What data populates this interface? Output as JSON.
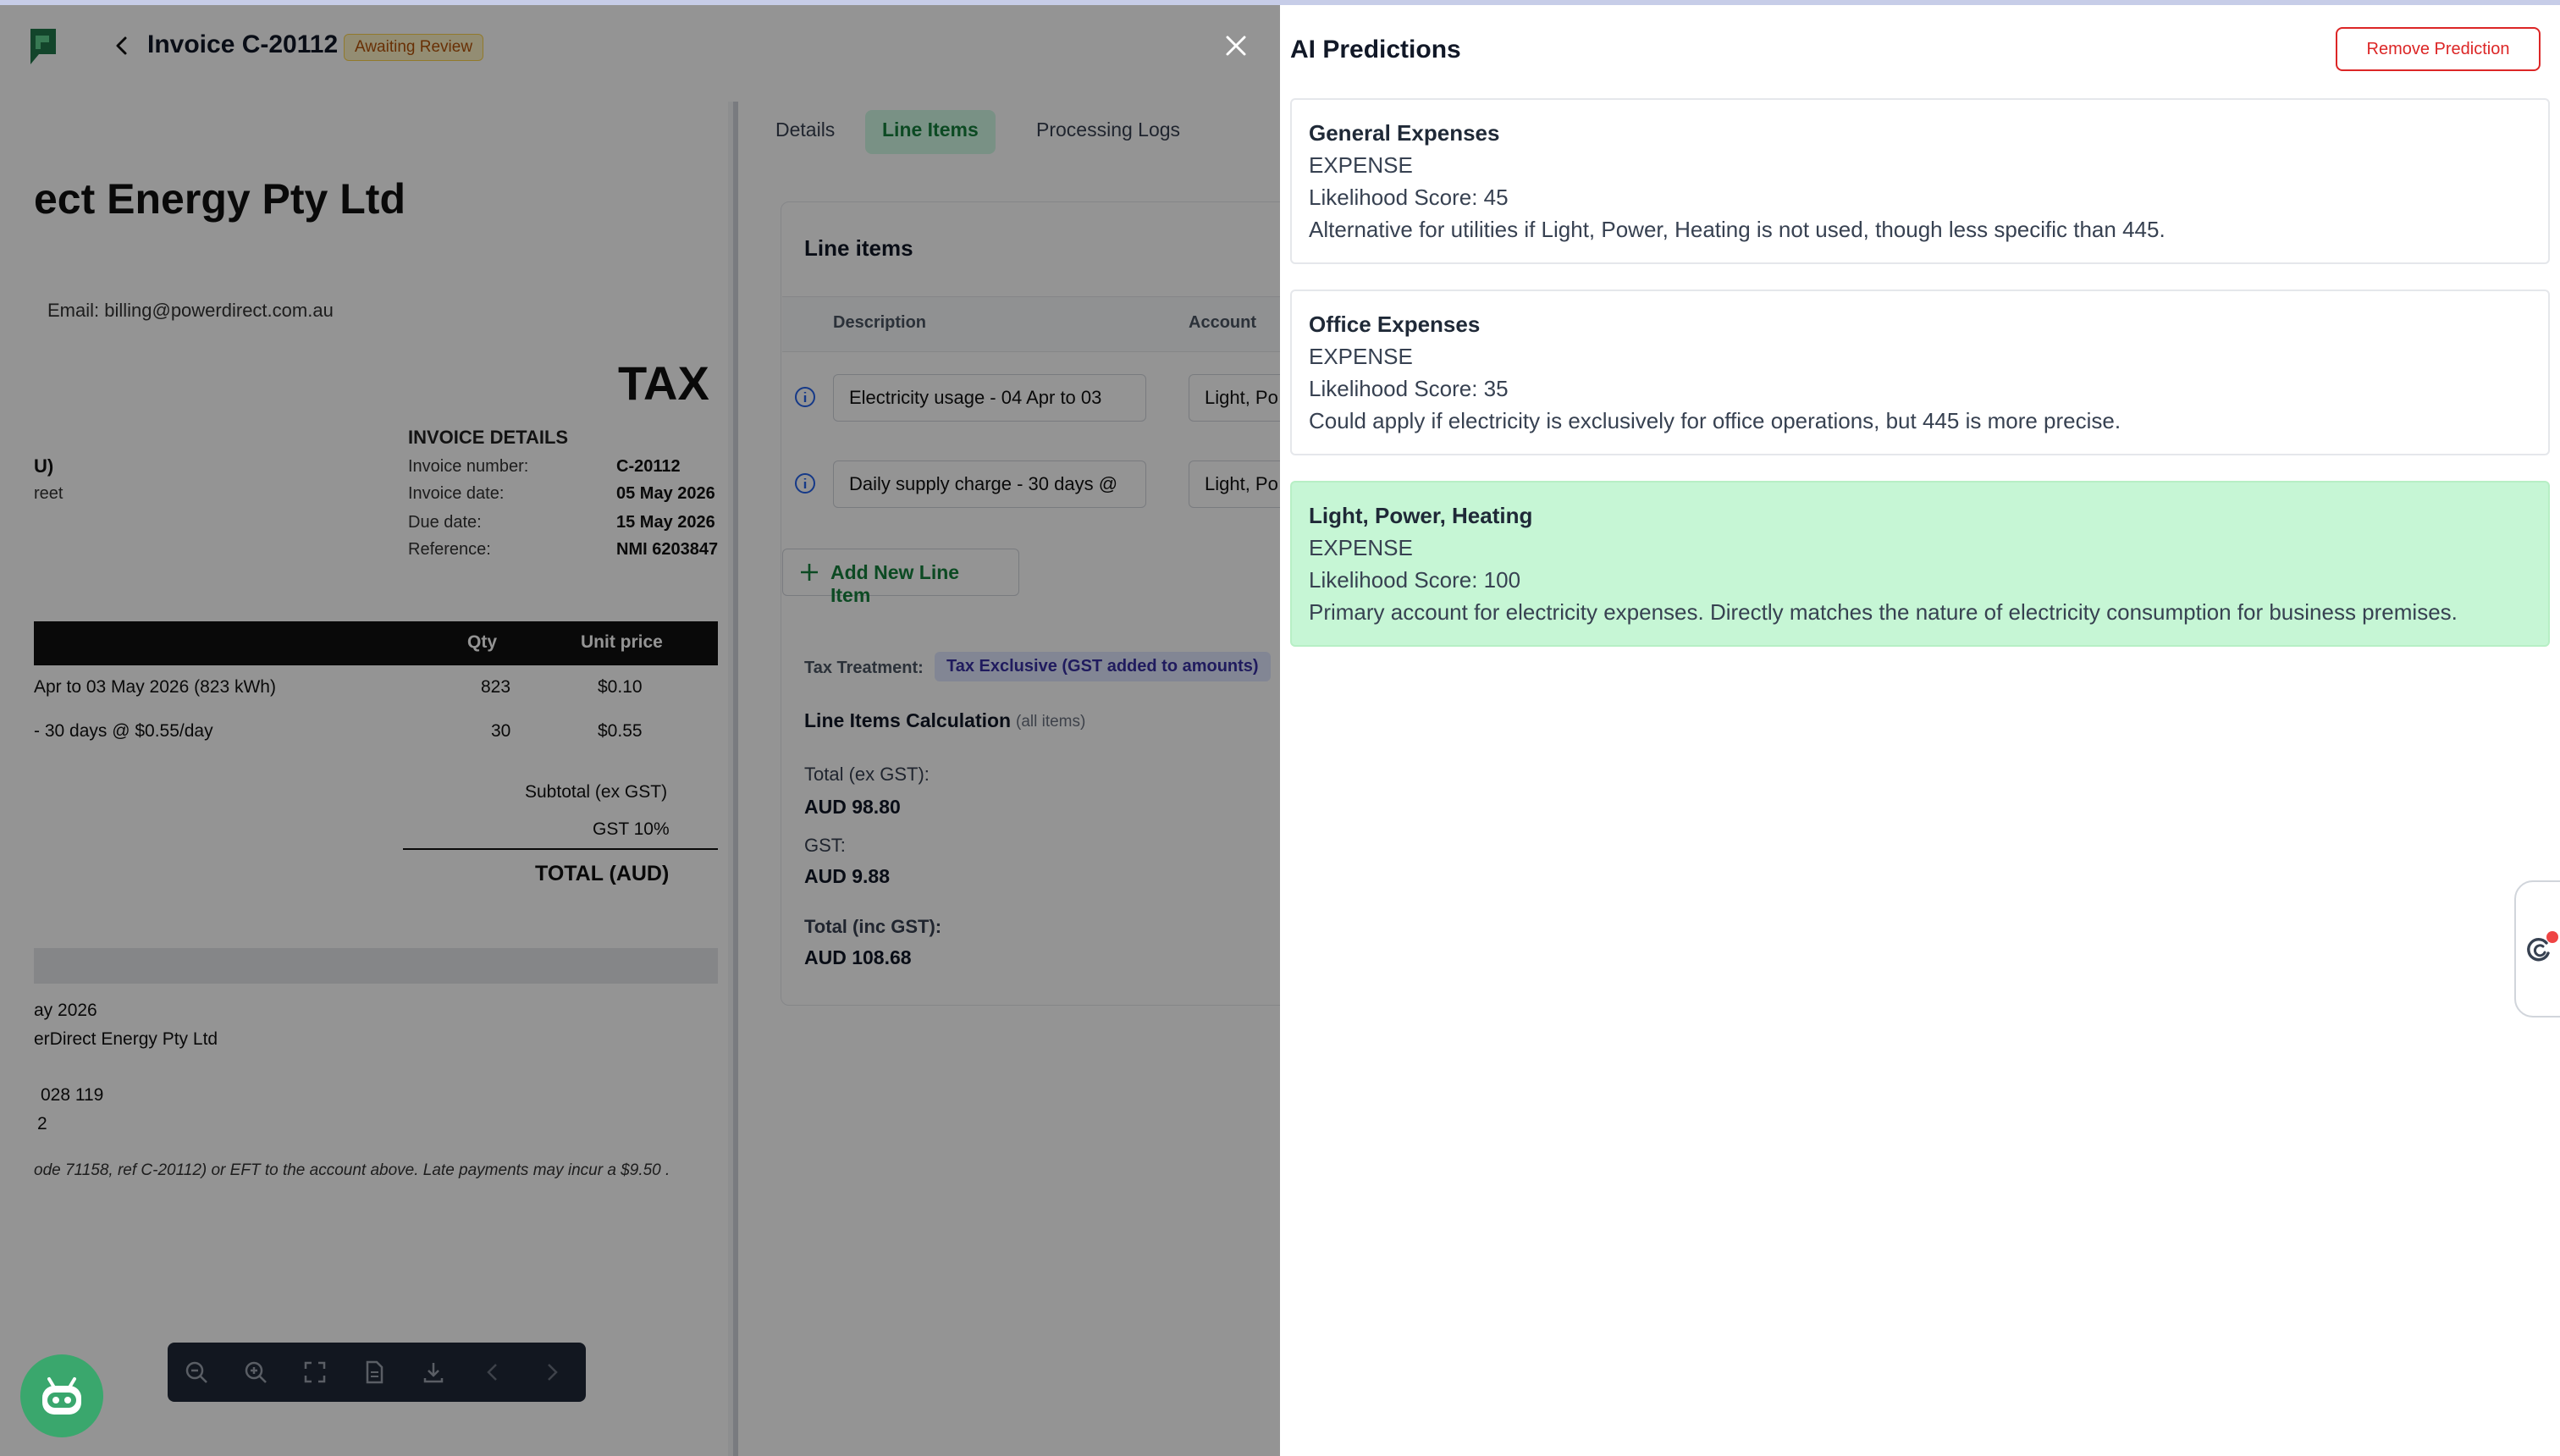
{
  "header": {
    "invoice_title": "Invoice C-20112",
    "status": "Awaiting Review"
  },
  "pdf": {
    "company_partial": "ect Energy Pty Ltd",
    "email": "Email: billing@powerdirect.com.au",
    "doc_type": "TAX",
    "details_heading": "INVOICE DETAILS",
    "details": [
      {
        "k": "Invoice number:",
        "v": "C-20112"
      },
      {
        "k": "Invoice date:",
        "v": "05 May 2026"
      },
      {
        "k": "Due date:",
        "v": "15 May 2026"
      },
      {
        "k": "Reference:",
        "v": "NMI 6203847"
      }
    ],
    "bill_to_partial": "U)",
    "street_partial": "reet",
    "table_headers": {
      "qty": "Qty",
      "unit_price": "Unit price"
    },
    "rows": [
      {
        "desc": "Apr to 03 May 2026 (823 kWh)",
        "qty": "823",
        "price": "$0.10"
      },
      {
        "desc": "- 30 days @ $0.55/day",
        "qty": "30",
        "price": "$0.55"
      }
    ],
    "subtotal_label": "Subtotal (ex GST)",
    "gst_label": "GST 10%",
    "total_label": "TOTAL (AUD)",
    "footer_1": "ay 2026",
    "footer_2": "erDirect Energy Pty Ltd",
    "footer_3": "028 119",
    "footer_4": "2",
    "footer_italic": "ode 71158, ref C-20112) or EFT to the account above. Late payments may incur a $9.50 ."
  },
  "tabs": [
    {
      "label": "Details"
    },
    {
      "label": "Line Items",
      "active": true
    },
    {
      "label": "Processing Logs"
    }
  ],
  "line_items": {
    "title": "Line items",
    "col_description": "Description",
    "col_account": "Account",
    "rows": [
      {
        "description": "Electricity usage - 04 Apr to 03",
        "account": "Light, Po"
      },
      {
        "description": "Daily supply charge - 30 days @",
        "account": "Light, Po"
      }
    ],
    "add_label": "Add New Line Item",
    "tax_treatment_label": "Tax Treatment:",
    "tax_treatment_value": "Tax Exclusive (GST added to amounts)",
    "calc_title": "Line Items Calculation",
    "calc_sub": "(all items)",
    "total_ex_label": "Total (ex GST):",
    "total_ex_value": "AUD 98.80",
    "gst_label": "GST:",
    "gst_value": "AUD 9.88",
    "total_inc_label": "Total (inc GST):",
    "total_inc_value": "AUD 108.68"
  },
  "drawer": {
    "title": "AI Predictions",
    "remove_label": "Remove Prediction",
    "predictions": [
      {
        "name": "General Expenses",
        "type": "EXPENSE",
        "score": "Likelihood Score: 45",
        "reason": "Alternative for utilities if Light, Power, Heating is not used, though less specific than 445.",
        "selected": false
      },
      {
        "name": "Office Expenses",
        "type": "EXPENSE",
        "score": "Likelihood Score: 35",
        "reason": "Could apply if electricity is exclusively for office operations, but 445 is more precise.",
        "selected": false
      },
      {
        "name": "Light, Power, Heating",
        "type": "EXPENSE",
        "score": "Likelihood Score: 100",
        "reason": "Primary account for electricity expenses. Directly matches the nature of electricity consumption for business premises.",
        "selected": true
      }
    ]
  },
  "colors": {
    "accent_green": "#15803d",
    "selected_bg": "#c6f6d5",
    "danger": "#dc2626",
    "bot_green": "#3aa76d"
  },
  "icons": [
    "logo-icon",
    "chevron-left-icon",
    "close-icon",
    "info-icon",
    "plus-icon",
    "zoom-out-icon",
    "zoom-in-icon",
    "fullscreen-icon",
    "document-icon",
    "download-icon",
    "chevron-left-icon",
    "chevron-right-icon",
    "robot-icon",
    "support-icon"
  ]
}
